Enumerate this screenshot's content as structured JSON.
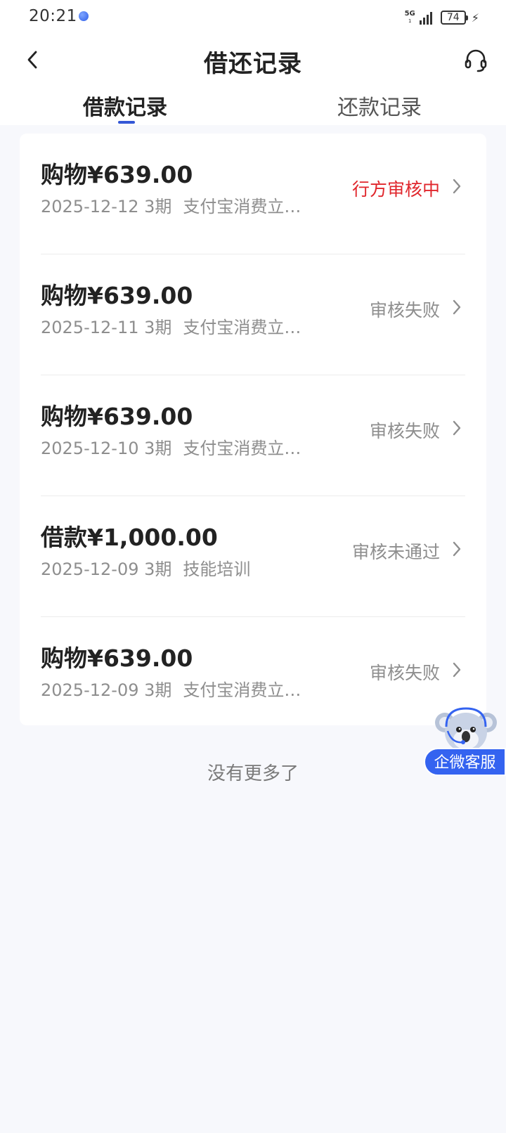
{
  "status_bar": {
    "time": "20:21",
    "network": "5G",
    "network_sub": "1",
    "battery": "74",
    "dot_color": "#3a67ee"
  },
  "nav": {
    "title": "借还记录",
    "back_icon": "chevron-left-icon",
    "service_icon": "headset-icon"
  },
  "tabs": [
    {
      "label": "借款记录",
      "active": true
    },
    {
      "label": "还款记录",
      "active": false
    }
  ],
  "colors": {
    "accent": "#3357d6",
    "pending_status": "#e0262c",
    "muted": "#8e8e8e",
    "float_button": "#3463f0"
  },
  "records": [
    {
      "amount": "购物¥639.00",
      "date": "2025-12-12 3期",
      "purpose": "支付宝消费立…",
      "status": "行方审核中",
      "status_type": "pending"
    },
    {
      "amount": "购物¥639.00",
      "date": "2025-12-11 3期",
      "purpose": "支付宝消费立…",
      "status": "审核失败",
      "status_type": "normal"
    },
    {
      "amount": "购物¥639.00",
      "date": "2025-12-10 3期",
      "purpose": "支付宝消费立…",
      "status": "审核失败",
      "status_type": "normal"
    },
    {
      "amount": "借款¥1,000.00",
      "date": "2025-12-09 3期",
      "purpose": "技能培训",
      "status": "审核未通过",
      "status_type": "normal"
    },
    {
      "amount": "购物¥639.00",
      "date": "2025-12-09 3期",
      "purpose": "支付宝消费立…",
      "status": "审核失败",
      "status_type": "normal"
    }
  ],
  "footer": {
    "no_more": "没有更多了"
  },
  "float_service": {
    "label": "企微客服",
    "icon": "koala-mascot-icon"
  }
}
